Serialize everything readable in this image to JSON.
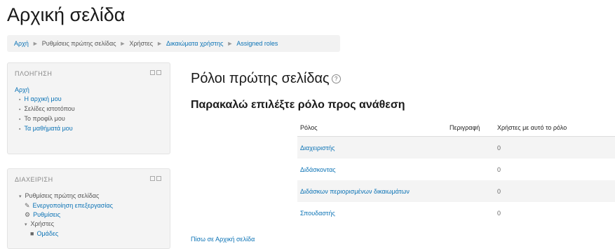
{
  "page": {
    "title": "Αρχική σελίδα"
  },
  "breadcrumb": [
    {
      "label": "Αρχή",
      "link": true
    },
    {
      "label": "Ρυθμίσεις πρώτης σελίδας",
      "link": false
    },
    {
      "label": "Χρήστες",
      "link": false
    },
    {
      "label": "Δικαιώματα χρήστης",
      "link": true
    },
    {
      "label": "Assigned roles",
      "link": true
    }
  ],
  "breadcrumb_separator": "►",
  "navigation": {
    "header": "ΠΛΟΗΓΗΣΗ",
    "home": "Αρχή",
    "items": [
      "Η αρχική μου",
      "Σελίδες ιστοτόπου",
      "Το προφίλ μου",
      "Τα μαθήματά μου"
    ]
  },
  "administration": {
    "header": "ΔΙΑΧΕΙΡΙΣΗ",
    "section": "Ρυθμίσεις πρώτης σελίδας",
    "items": [
      "Ενεργοποίηση επεξεργασίας",
      "Ρυθμίσεις",
      "Χρήστες",
      "Ομάδες"
    ]
  },
  "main": {
    "heading": "Ρόλοι πρώτης σελίδας",
    "subheading": "Παρακαλώ επιλέξτε ρόλο προς ανάθεση",
    "back_link": "Πίσω σε Αρχική σελίδα",
    "table": {
      "headers": [
        "Ρόλος",
        "Περιγραφή",
        "Χρήστες με αυτό το ρόλο"
      ],
      "rows": [
        {
          "role": "Διαχειριστής",
          "description": "",
          "count": "0"
        },
        {
          "role": "Διδάσκοντας",
          "description": "",
          "count": "0"
        },
        {
          "role": "Διδάσκων περιορισμένων δικαιωμάτων",
          "description": "",
          "count": "0"
        },
        {
          "role": "Σπουδαστής",
          "description": "",
          "count": "0"
        }
      ]
    }
  },
  "icons": {
    "help": "?",
    "edit": "✎",
    "settings": "⚙",
    "users_folder": "▾",
    "groups": "■",
    "bullet": "▪",
    "expand": "▾"
  },
  "colors": {
    "link": "#0a72b5",
    "block_bg": "#f4f4f4",
    "stripe": "#f4f4f4"
  }
}
